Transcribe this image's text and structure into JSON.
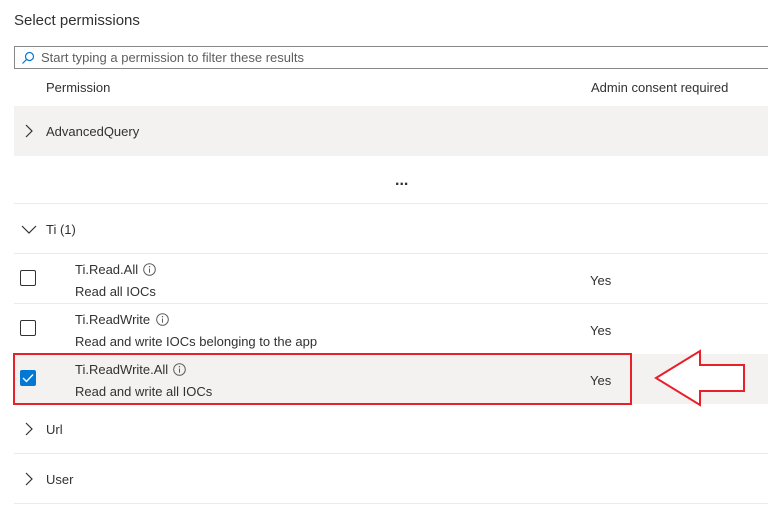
{
  "title": "Select permissions",
  "search": {
    "placeholder": "Start typing a permission to filter these results"
  },
  "columns": {
    "permission": "Permission",
    "admin_consent": "Admin consent required"
  },
  "groups": {
    "advanced_query": "AdvancedQuery",
    "more": "...",
    "ti": "Ti (1)",
    "url": "Url",
    "user": "User"
  },
  "permissions": [
    {
      "name": "Ti.Read.All",
      "description": "Read all IOCs",
      "admin_consent": "Yes",
      "checked": false
    },
    {
      "name": "Ti.ReadWrite",
      "description": "Read and write IOCs belonging to the app",
      "admin_consent": "Yes",
      "checked": false
    },
    {
      "name": "Ti.ReadWrite.All",
      "description": "Read and write all IOCs",
      "admin_consent": "Yes",
      "checked": true
    }
  ],
  "icons": {
    "search": "search-icon",
    "chevron_right": "chevron-right-icon",
    "chevron_down": "chevron-down-icon",
    "info": "info-icon",
    "checkmark": "checkmark-icon",
    "callout_arrow": "arrow-left-icon"
  },
  "colors": {
    "accent": "#0078d4",
    "selected_row": "#f3f2f1",
    "annotation": "#e8202a"
  }
}
